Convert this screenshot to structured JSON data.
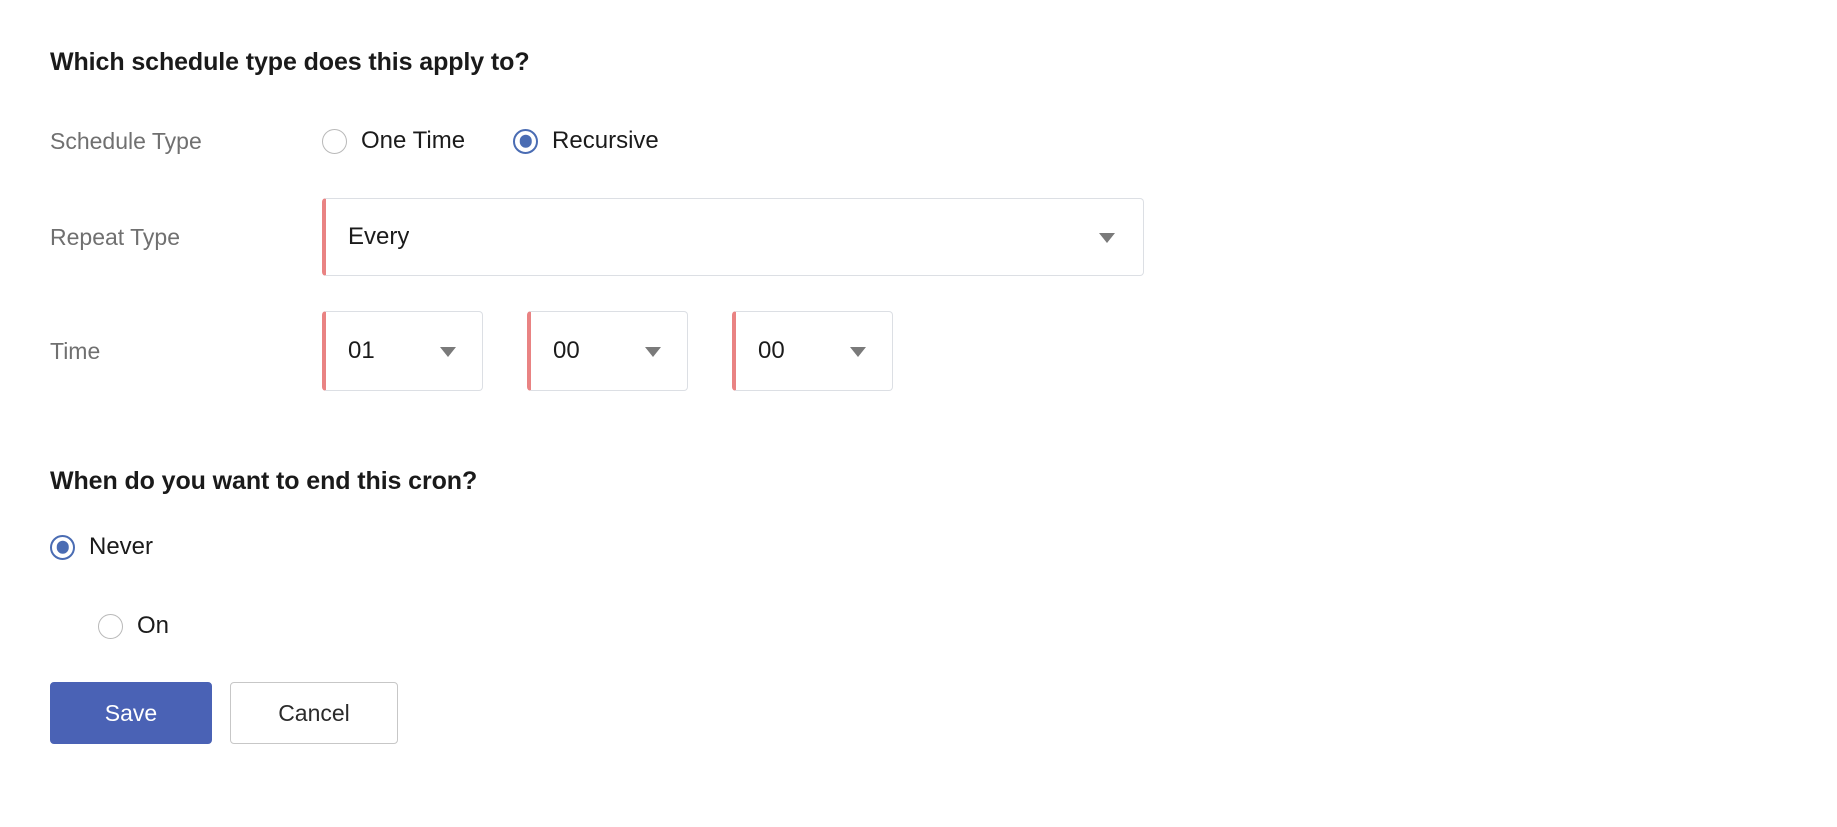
{
  "form": {
    "sections": [
      {
        "heading": "Which schedule type does this apply to?"
      },
      {
        "heading": "When do you want to end this cron?"
      }
    ],
    "schedule_type": {
      "label": "Schedule Type",
      "options": [
        {
          "label": "One Time",
          "selected": false
        },
        {
          "label": "Recursive",
          "selected": true
        }
      ]
    },
    "repeat_type": {
      "label": "Repeat Type",
      "value": "Every",
      "caret_icon": "chevron-down-icon"
    },
    "time": {
      "label": "Time",
      "selects": [
        {
          "name": "hours",
          "value": "01",
          "caret_icon": "chevron-down-icon"
        },
        {
          "name": "minutes",
          "value": "00",
          "caret_icon": "chevron-down-icon"
        },
        {
          "name": "seconds",
          "value": "00",
          "caret_icon": "chevron-down-icon"
        }
      ]
    },
    "end_condition": {
      "options": [
        {
          "label": "Never",
          "selected": true
        },
        {
          "label": "On",
          "selected": false
        }
      ]
    },
    "actions": {
      "save_label": "Save",
      "cancel_label": "Cancel"
    }
  },
  "colors": {
    "accent_blue": "#4a6cb3",
    "button_blue": "#4a62b5",
    "field_accent_red": "#e98383",
    "label_gray": "#707070",
    "border_gray": "#dcdfe4",
    "text_dark": "#1b1b1b"
  }
}
